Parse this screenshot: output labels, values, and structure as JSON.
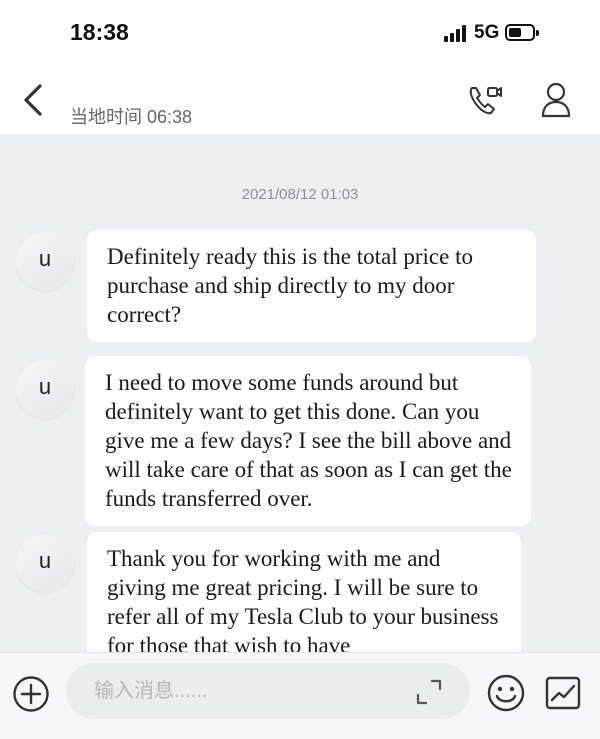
{
  "status_bar": {
    "time": "18:38",
    "network": "5G"
  },
  "header": {
    "local_time": "当地时间 06:38"
  },
  "chat": {
    "date_stamp": "2021/08/12 01:03",
    "messages": [
      {
        "avatar_letter": "u",
        "text": "Definitely ready this is the total price to purchase and ship directly to my door correct?"
      },
      {
        "avatar_letter": "u",
        "text": "I need to move some funds around but definitely want to get this done.  Can you give me a few days?   I see the bill above and will take care of that as soon as I can get the funds transferred over."
      },
      {
        "avatar_letter": "u",
        "text": "Thank you for working with me and giving me great pricing.  I will be sure to refer all of my Tesla Club to your business for those that wish to have"
      }
    ]
  },
  "input_bar": {
    "placeholder": "输入消息......",
    "value": ""
  },
  "icons": {
    "back": "chevron-left-icon",
    "video_call": "video-call-icon",
    "profile": "person-icon",
    "add": "plus-circle-icon",
    "expand": "expand-icon",
    "emoji": "smiley-icon",
    "chart": "chart-icon"
  },
  "colors": {
    "chat_background": "#edeff3",
    "bubble": "#ffffff"
  }
}
